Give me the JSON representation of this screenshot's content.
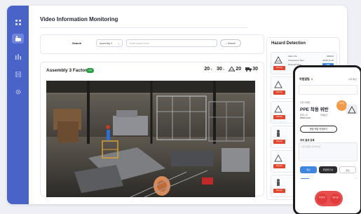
{
  "page": {
    "title": "Video Information Monitoring"
  },
  "search": {
    "label": "Search",
    "select_value": "Assembly 3",
    "input_placeholder": "Enter search term",
    "button_label": "Search"
  },
  "factory": {
    "title": "Assembly 3 Factory",
    "status_badge": "ON",
    "stats": [
      {
        "icon": "worker-icon",
        "value": "20",
        "unit": "명"
      },
      {
        "icon": "vehicle-icon",
        "value": "30",
        "unit": "%"
      },
      {
        "icon": "crane-icon",
        "value": "20",
        "unit": ""
      },
      {
        "icon": "truck-icon",
        "value": "30",
        "unit": ""
      }
    ]
  },
  "hazard": {
    "title": "Hazard Detection",
    "first_item": {
      "rows": [
        {
          "label": "Alarm No.",
          "value": "349124"
        },
        {
          "label": "Occurrence Time",
          "value": "05/25 11:30"
        },
        {
          "label": "Proceed Time",
          "value": "Start"
        }
      ],
      "tag": "Density"
    },
    "tag_label": "Density"
  },
  "phone": {
    "header": "위험알림",
    "count": "3",
    "edit": "이력 확인",
    "subheading": "안전 이벤트",
    "alert_title": "PPE 착용 위반",
    "orange_badge": "미처리",
    "meta": [
      {
        "label": "발생 시간",
        "value": "05/25 12:40"
      },
      {
        "label": "위험등급",
        "value": "-"
      }
    ],
    "action_button": "현장 작업 안내하기",
    "section_title": "처리 결과 등록",
    "textarea_placeholder": "처리 내용을 입력하세요",
    "buttons": [
      "확인",
      "위험물건 반",
      "취소"
    ],
    "fab_labels": [
      "작업중지",
      "비상호출"
    ]
  },
  "colors": {
    "sidebar": "#4a63c9",
    "accent_red": "#e0452e",
    "accent_blue": "#3f86e0",
    "badge_green": "#2e9e45"
  }
}
